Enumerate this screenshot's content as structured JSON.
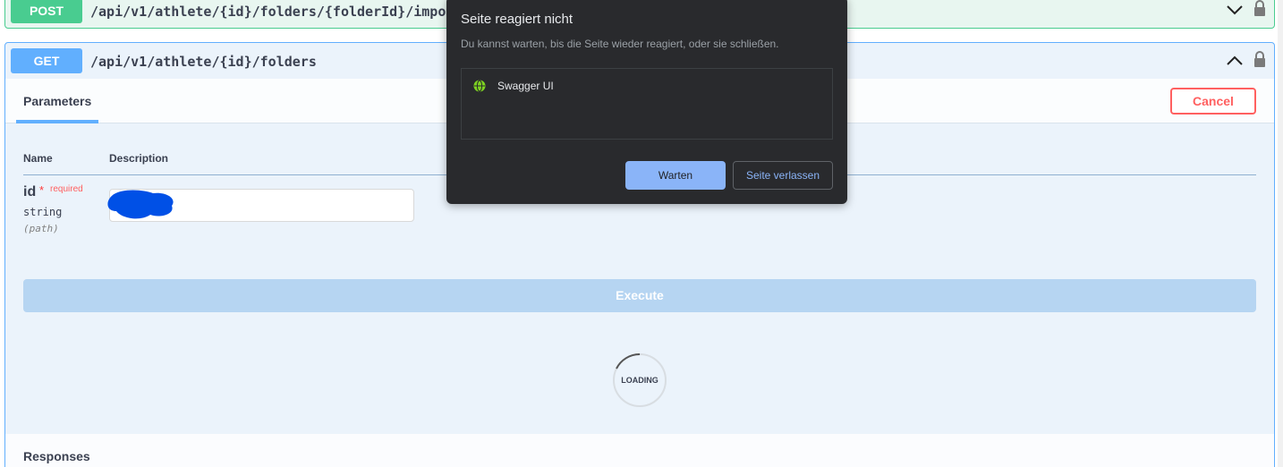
{
  "post_op": {
    "method": "POST",
    "path": "/api/v1/athlete/{id}/folders/{folderId}/import"
  },
  "get_op": {
    "method": "GET",
    "path": "/api/v1/athlete/{id}/folders",
    "tab_parameters": "Parameters",
    "cancel_label": "Cancel",
    "columns": {
      "name": "Name",
      "description": "Description"
    },
    "param": {
      "name": "id",
      "required_star": "*",
      "required_label": "required",
      "type": "string",
      "location": "(path)",
      "value": ""
    },
    "execute_label": "Execute",
    "loading_label": "LOADING",
    "responses_title": "Responses"
  },
  "dialog": {
    "title": "Seite reagiert nicht",
    "message": "Du kannst warten, bis die Seite wieder reagiert, oder sie schließen.",
    "items": [
      {
        "label": "Swagger UI"
      }
    ],
    "wait_label": "Warten",
    "leave_label": "Seite verlassen"
  },
  "colors": {
    "post": "#49cc90",
    "get": "#61affe",
    "cancel": "#ff6060",
    "dialog_bg": "#292a2d",
    "dialog_accent": "#8ab4f8",
    "redaction": "#0050e6"
  },
  "icons": [
    "chevron-down-icon",
    "chevron-up-icon",
    "lock-icon",
    "globe-icon",
    "loading-spinner-icon"
  ]
}
